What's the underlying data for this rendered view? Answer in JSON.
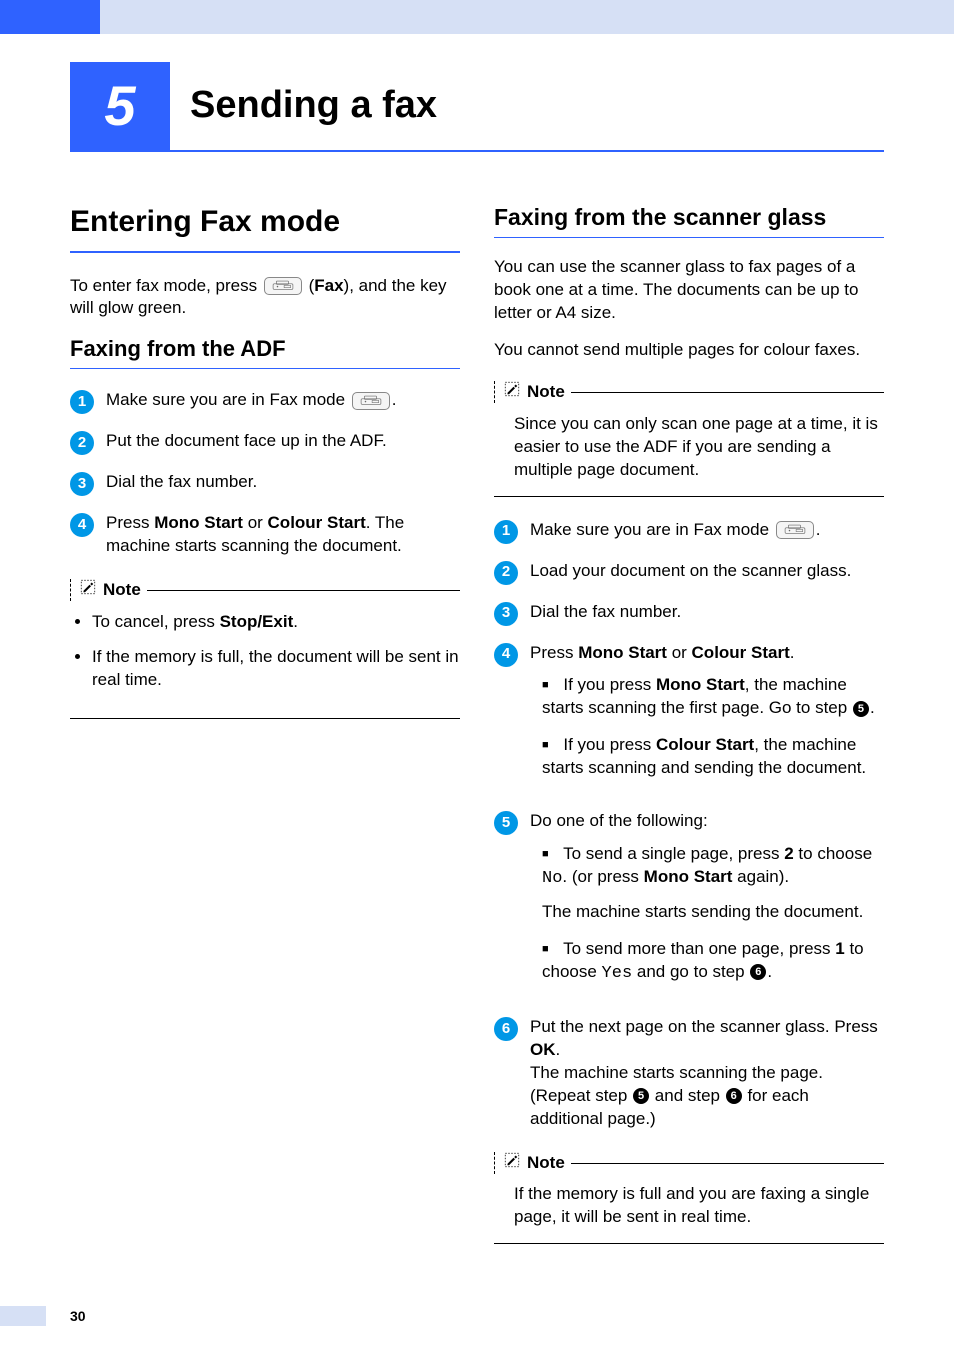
{
  "chapter": {
    "num": "5",
    "title": "Sending a fax"
  },
  "left": {
    "h1": "Entering Fax mode",
    "intro_a": "To enter fax mode, press ",
    "intro_b": " (",
    "intro_bold": "Fax",
    "intro_c": "), and the key will glow green.",
    "h2": "Faxing from the ADF",
    "steps": {
      "s1_a": "Make sure you are in Fax mode ",
      "s1_b": ".",
      "s2": "Put the document face up in the ADF.",
      "s3": "Dial the fax number.",
      "s4_a": "Press ",
      "s4_b": "Mono Start",
      "s4_c": " or ",
      "s4_d": "Colour Start",
      "s4_e": ". The machine starts scanning the document."
    },
    "note": {
      "label": "Note",
      "b1_a": "To cancel, press ",
      "b1_b": "Stop/Exit",
      "b1_c": ".",
      "b2": "If the memory is full, the document will be sent in real time."
    }
  },
  "right": {
    "h2": "Faxing from the scanner glass",
    "p1": "You can use the scanner glass to fax pages of a book one at a time. The documents can be up to letter or A4 size.",
    "p2": "You cannot send multiple pages for colour faxes.",
    "note1": {
      "label": "Note",
      "text": "Since you can only scan one page at a time, it is easier to use the ADF if you are sending a multiple page document."
    },
    "steps": {
      "s1_a": "Make sure you are in Fax mode ",
      "s1_b": ".",
      "s2": "Load your document on the scanner glass.",
      "s3": "Dial the fax number.",
      "s4_a": "Press ",
      "s4_b": "Mono Start",
      "s4_c": " or ",
      "s4_d": "Colour Start",
      "s4_e": ".",
      "s4u1_a": "If you press ",
      "s4u1_b": "Mono Start",
      "s4u1_c": ", the machine starts scanning the first page. Go to step ",
      "s4u1_ref": "5",
      "s4u1_d": ".",
      "s4u2_a": "If you press ",
      "s4u2_b": "Colour Start",
      "s4u2_c": ", the machine starts scanning and sending the document.",
      "s5_lead": "Do one of the following:",
      "s5u1_a": "To send a single page, press ",
      "s5u1_b": "2",
      "s5u1_c": " to choose ",
      "s5u1_mono": "No",
      "s5u1_d": ". (or press ",
      "s5u1_e": "Mono Start",
      "s5u1_f": " again).",
      "s5u1_tail": "The machine starts sending the document.",
      "s5u2_a": "To send more than one page, press ",
      "s5u2_b": "1",
      "s5u2_c": " to choose ",
      "s5u2_mono": "Yes",
      "s5u2_d": " and go to step ",
      "s5u2_ref": "6",
      "s5u2_e": ".",
      "s6_a": "Put the next page on the scanner glass. Press ",
      "s6_b": "OK",
      "s6_c": ".",
      "s6_d": "The machine starts scanning the page. (Repeat step ",
      "s6_ref1": "5",
      "s6_e": " and step ",
      "s6_ref2": "6",
      "s6_f": " for each additional page.)"
    },
    "note2": {
      "label": "Note",
      "text": "If the memory is full and you are faxing a single page, it will be sent in real time."
    }
  },
  "page_number": "30"
}
